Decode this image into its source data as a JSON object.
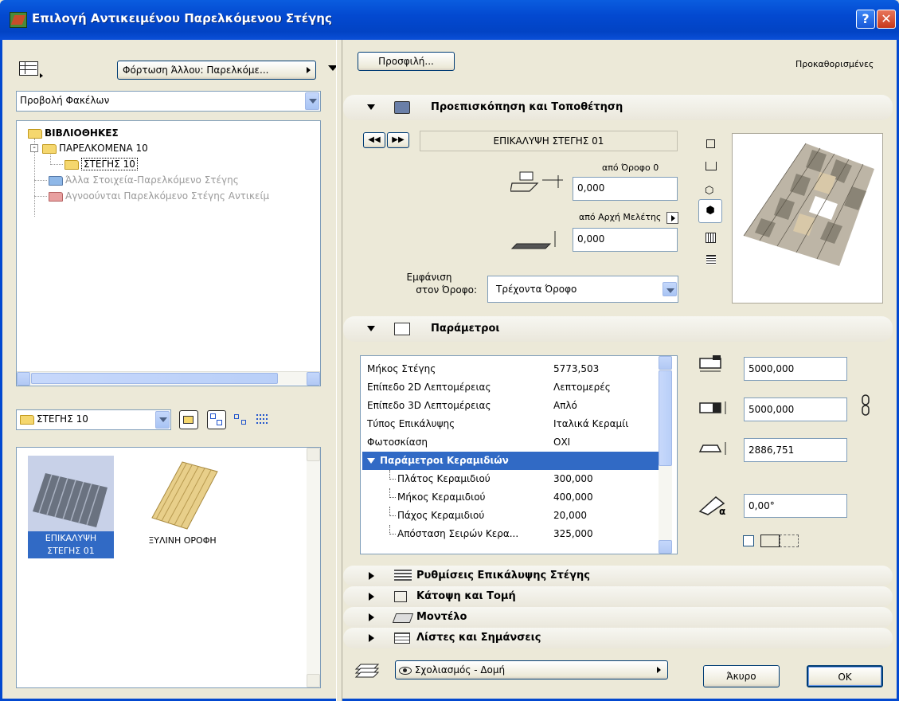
{
  "window": {
    "title": "Επιλογή Αντικειμένου Παρελκόμενου Στέγης",
    "help_glyph": "?",
    "close_glyph": "✕"
  },
  "left": {
    "load_other": "Φόρτωση Άλλου: Παρελκόμε...",
    "view_mode": "Προβολή Φακέλων",
    "tree": [
      {
        "label": "ΒΙΒΛΙΟΘΗΚΕΣ"
      },
      {
        "label": "ΠΑΡΕΛΚΟΜΕΝΑ 10"
      },
      {
        "label": "ΣΤΕΓΗΣ 10"
      },
      {
        "label": "Άλλα Στοιχεία-Παρελκόμενο Στέγης"
      },
      {
        "label": "Αγνοούνται Παρελκόμενο Στέγης Αντικείμ"
      }
    ],
    "folder_select": "ΣΤΕΓΗΣ 10",
    "items": [
      {
        "label_1": "ΕΠΙΚΑΛΥΨΗ",
        "label_2": "ΣΤΕΓΗΣ 01"
      },
      {
        "label_1": "ΞΥΛΙΝΗ ΟΡΟΦΗ"
      }
    ]
  },
  "right": {
    "favorites": "Προσφιλή...",
    "defaults": "Προκαθορισμένες",
    "preview": {
      "title": "Προεπισκόπηση και Τοποθέτηση",
      "object_name": "ΕΠΙΚΑΛΥΨΗ ΣΤΕΓΗΣ 01",
      "from_story": "από Όροφο 0",
      "story_offset": "0,000",
      "from_project": "από Αρχή Μελέτης",
      "project_offset": "0,000",
      "show_on_story_l1": "Εμφάνιση",
      "show_on_story_l2": "στον Όροφο:",
      "story_option": "Τρέχοντα Όροφο"
    },
    "params": {
      "title": "Παράμετροι",
      "rows": [
        {
          "name": "Μήκος Στέγης",
          "value": "5773,503"
        },
        {
          "name": "Επίπεδο 2D Λεπτομέρειας",
          "value": "Λεπτομερές"
        },
        {
          "name": "Επίπεδο 3D Λεπτομέρειας",
          "value": "Απλό"
        },
        {
          "name": "Τύπος Επικάλυψης",
          "value": "Ιταλικά Κεραμίι"
        },
        {
          "name": "Φωτοσκίαση",
          "value": "ΟΧΙ"
        },
        {
          "name": "Παράμετροι Κεραμιδιών",
          "value": ""
        },
        {
          "name": "Πλάτος Κεραμιδιού",
          "value": "300,000"
        },
        {
          "name": "Μήκος Κεραμιδιού",
          "value": "400,000"
        },
        {
          "name": "Πάχος Κεραμιδιού",
          "value": "20,000"
        },
        {
          "name": "Απόσταση Σειρών Κερα...",
          "value": "325,000"
        }
      ],
      "width": "5000,000",
      "depth": "5000,000",
      "height": "2886,751",
      "angle": "0,00°"
    },
    "collapsed": [
      "Ρυθμίσεις Επικάλυψης Στέγης",
      "Κάτοψη και Τομή",
      "Μοντέλο",
      "Λίστες και Σημάνσεις"
    ],
    "layer": "Σχολιασμός - Δομή",
    "cancel": "Άκυρο",
    "ok": "OK"
  }
}
